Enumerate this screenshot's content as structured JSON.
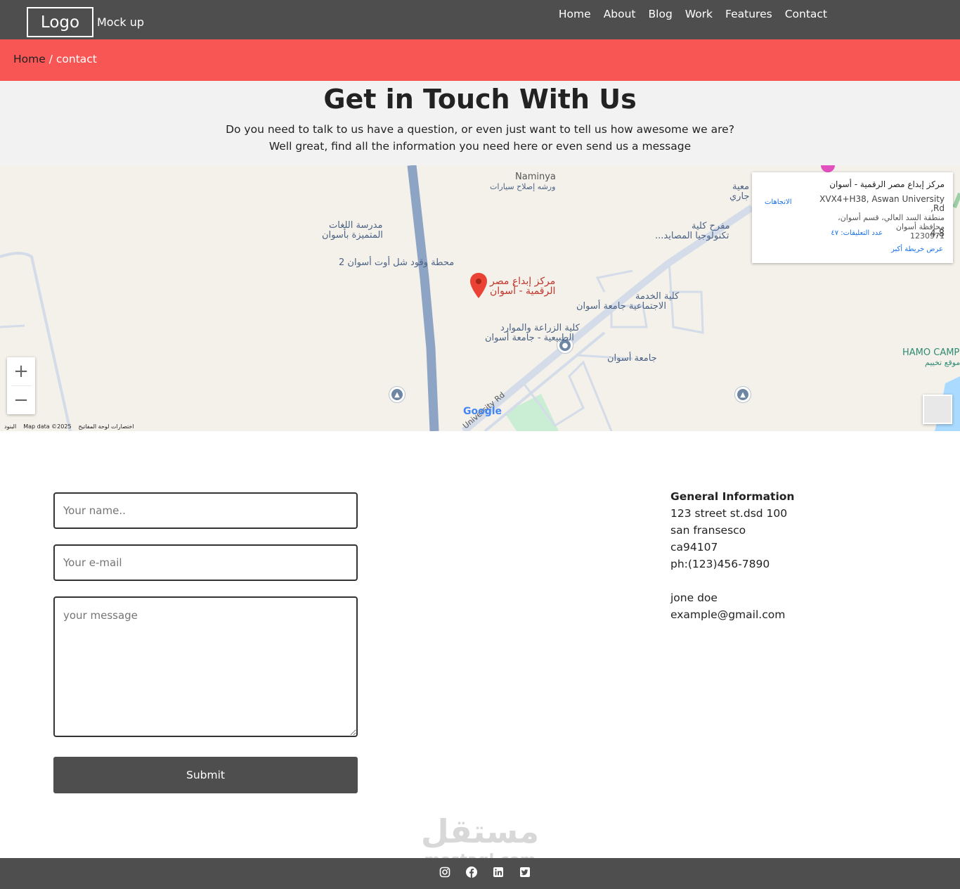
{
  "nav": {
    "logo": "Logo",
    "subtitle": "Mock up",
    "links": [
      "Home",
      "About",
      "Blog",
      "Work",
      "Features",
      "Contact"
    ]
  },
  "breadcrumb": {
    "home": "Home",
    "separator": " / ",
    "current": "contact"
  },
  "hero": {
    "title": "Get in Touch With Us",
    "line1": "Do you need to talk to us have a question, or even just want to tell us how awesome we are?",
    "line2": "Well great, find all the information you need here or even send us a message"
  },
  "map": {
    "labels": {
      "naminya": "Naminya",
      "naminya_sub": "ورشه إصلاح سيارات",
      "school1": "مدرسة اللغات",
      "school2": "المتميزة بأسوان",
      "station": "محطة وقود شل أوت أسوان 2",
      "place1": "مركز إبداع مصر",
      "place2": "الرقمية - أسوان",
      "service1": "كلية الخدمة",
      "service2": "الاجتماعية جامعة أسوان",
      "agri1": "كلية الزراعة والموارد",
      "agri2": "الطبيعية - جامعة أسوان",
      "univ": "جامعة أسوان",
      "tech1": "مفرح كلية",
      "tech2": "تكنولوجيا المصايد...",
      "edge1": "معية",
      "edge2": "جاري",
      "hamo": "HAMO CAMP",
      "hamo_sub": "موقع تخييم",
      "road": "University Rd",
      "google": "Google"
    },
    "card": {
      "title": "مركز إبداع مصر الرقمية - أسوان",
      "address1": "XVX4+H38, Aswan University Rd,",
      "address2": "منطقة السد العالي، قسم أسوان، محافظة أسوان",
      "address3": "1230971",
      "directions": "الاتجاهات",
      "rating": "4.8",
      "reviews": "عدد التعليقات: ٤٧",
      "view_larger": "عرض خريطة أكبر"
    },
    "footer": [
      "البنود",
      "Map data ©2025",
      "اختصارات لوحة المفاتيح"
    ],
    "zoom_in": "+",
    "zoom_out": "−"
  },
  "form": {
    "name_placeholder": "Your name..",
    "email_placeholder": "Your e-mail",
    "message_placeholder": "your message",
    "submit": "Submit"
  },
  "general": {
    "heading": "General Information",
    "address1": "123 street st.dsd 100",
    "address2": "san fransesco",
    "address3": "ca94107",
    "phone": "ph:(123)456-7890",
    "name": "jone doe",
    "email": "example@gmail.com"
  },
  "watermark": {
    "arabic": "مستقل",
    "latin": "mostaql.com"
  },
  "footer": {
    "icons": [
      "instagram-icon",
      "facebook-icon",
      "linkedin-icon",
      "twitter-icon"
    ]
  }
}
